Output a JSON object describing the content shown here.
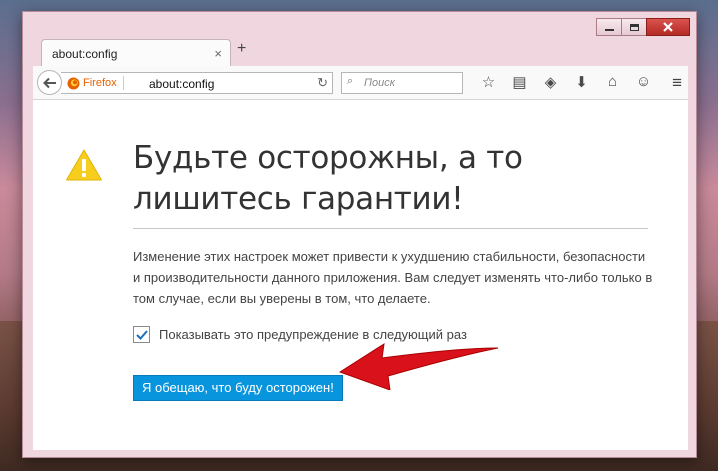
{
  "tab": {
    "title": "about:config",
    "close": "×",
    "new_tab": "+"
  },
  "urlbar": {
    "identity": "Firefox",
    "url": "about:config"
  },
  "search": {
    "placeholder": "Поиск"
  },
  "page": {
    "heading": "Будьте осторожны, а то лишитесь гарантии!",
    "description": "Изменение этих настроек может привести к ухудшению стабильности, безопасности и производительности данного приложения. Вам следует изменять что-либо только в том случае, если вы уверены в том, что делаете.",
    "checkbox_label": "Показывать это предупреждение в следующий раз",
    "checkbox_checked": true,
    "accept_button": "Я обещаю, что буду осторожен!"
  },
  "colors": {
    "accent": "#0995dd",
    "warning": "#f7ce1d",
    "arrow": "#d8111b"
  },
  "icons": [
    "back-arrow-icon",
    "firefox-logo-icon",
    "reload-icon",
    "search-icon",
    "bookmark-star-icon",
    "reading-list-icon",
    "pocket-icon",
    "download-icon",
    "home-icon",
    "smiley-icon",
    "hamburger-menu-icon",
    "warning-icon"
  ]
}
